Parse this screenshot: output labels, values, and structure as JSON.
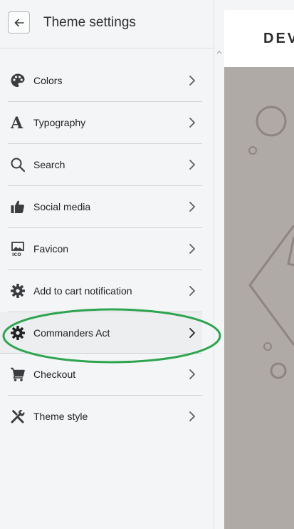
{
  "header": {
    "back_icon": "arrow-left-icon",
    "title": "Theme settings"
  },
  "menu": {
    "items": [
      {
        "label": "Colors",
        "icon": "palette-icon"
      },
      {
        "label": "Typography",
        "icon": "typography-icon"
      },
      {
        "label": "Search",
        "icon": "search-icon"
      },
      {
        "label": "Social media",
        "icon": "thumbs-up-icon"
      },
      {
        "label": "Favicon",
        "icon": "favicon-icon"
      },
      {
        "label": "Add to cart notification",
        "icon": "gear-icon"
      },
      {
        "label": "Commanders Act",
        "icon": "gear-icon",
        "hovered": true
      },
      {
        "label": "Checkout",
        "icon": "cart-icon"
      },
      {
        "label": "Theme style",
        "icon": "tools-icon"
      }
    ]
  },
  "preview": {
    "brand_text": "DEV",
    "hero_color": "#b0aaa7"
  },
  "annotation": {
    "color": "#2ea44f"
  }
}
